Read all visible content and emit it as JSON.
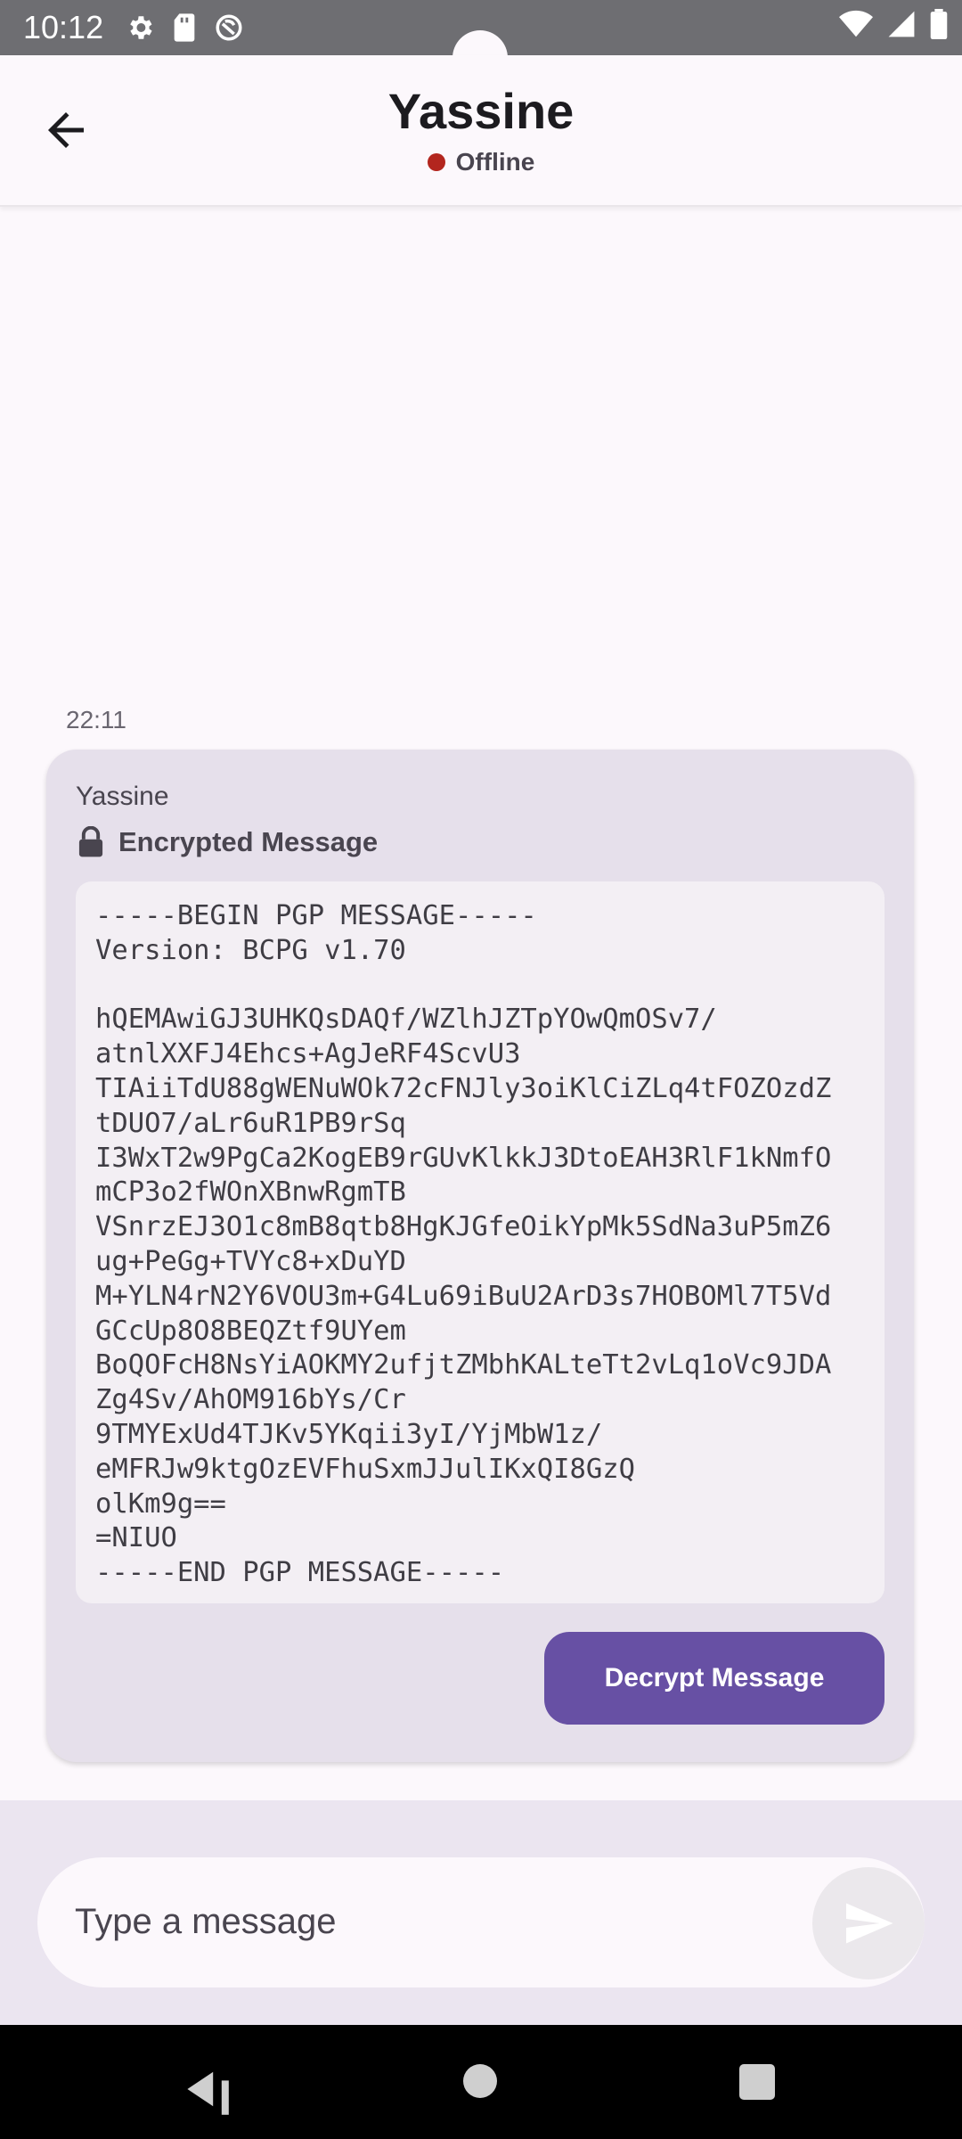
{
  "status_bar": {
    "time": "10:12",
    "icons": [
      "gear-icon",
      "sd-card-icon",
      "vpn-icon",
      "wifi-icon",
      "signal-icon",
      "battery-icon"
    ]
  },
  "header": {
    "title": "Yassine",
    "status": "Offline",
    "status_color": "#b3261e"
  },
  "messages": [
    {
      "time": "22:11",
      "sender": "Yassine",
      "encrypted_label": "Encrypted Message",
      "pgp_text": "-----BEGIN PGP MESSAGE-----\nVersion: BCPG v1.70\n\nhQEMAwiGJ3UHKQsDAQf/WZlhJZTpYOwQmOSv7/\natnlXXFJ4Ehcs+AgJeRF4ScvU3\nTIAiiTdU88gWENuWOk72cFNJly3oiKlCiZLq4tFOZOzdZ\ntDUO7/aLr6uR1PB9rSq\nI3WxT2w9PgCa2KogEB9rGUvKlkkJ3DtoEAH3RlF1kNmfO\nmCP3o2fWOnXBnwRgmTB\nVSnrzEJ3O1c8mB8qtb8HgKJGfeOikYpMk5SdNa3uP5mZ6\nug+PeGg+TVYc8+xDuYD\nM+YLN4rN2Y6VOU3m+G4Lu69iBuU2ArD3s7HOBOMl7T5Vd\nGCcUp8O8BEQZtf9UYem\nBoQOFcH8NsYiAOKMY2ufjtZMbhKALteTt2vLq1oVc9JDA\nZg4Sv/AhOM916bYs/Cr\n9TMYExUd4TJKv5YKqii3yI/YjMbW1z/\neMFRJw9ktgOzEVFhuSxmJJulIKxQI8GzQ\nolKm9g==\n=NIUO\n-----END PGP MESSAGE-----",
      "decrypt_label": "Decrypt Message"
    }
  ],
  "composer": {
    "placeholder": "Type a message"
  },
  "colors": {
    "accent": "#6750a4",
    "bubble": "#e6e0eb",
    "background": "#fcf8fc"
  }
}
